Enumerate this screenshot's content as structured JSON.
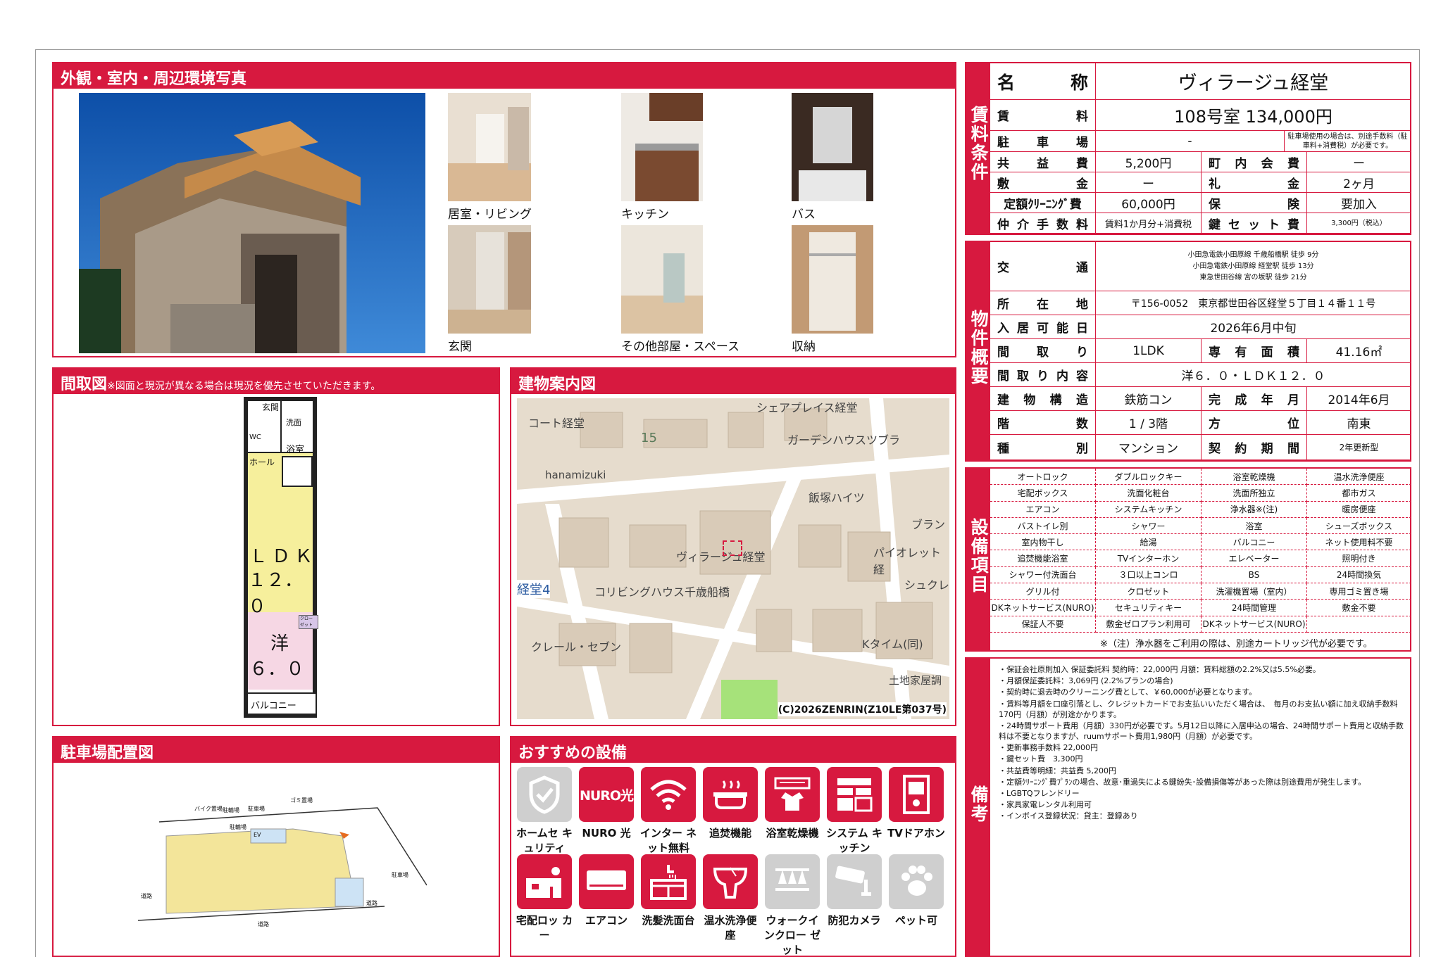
{
  "titles": {
    "photos": "外観・室内・周辺環境写真",
    "floorplan": "間取図",
    "floorplan_note": "※図面と現況が異なる場合は現況を優先させていただきます。",
    "map": "建物案内図",
    "parking": "駐車場配置図",
    "recommended": "おすすめの設備"
  },
  "photo_labels": [
    "居室・リビング",
    "キッチン",
    "バス",
    "玄関",
    "その他部屋・スペース",
    "収納"
  ],
  "floorplan": {
    "entrance": "玄関",
    "wash": "洗面",
    "wc": "WC",
    "bath": "浴室",
    "hall": "ホール",
    "ldk_1": "ＬＤＫ",
    "ldk_2": "１２．０",
    "closet": "クロー ゼット",
    "western_1": "洋",
    "western_2": "６．０",
    "balcony": "バルコニー"
  },
  "map": {
    "labels": [
      "シェアプレイス経堂",
      "コート経堂",
      "15",
      "ガーデンハウスツブラ",
      "hanamizuki",
      "飯塚ハイツ",
      "ブラン",
      "ヴィラージュ経堂",
      "パイオレット経",
      "経堂4",
      "コリビングハウス千歳船橋",
      "シュクレ",
      "クレール・セブン",
      "Kタイム(同)",
      "土地家屋調"
    ],
    "copyright": "(C)2026ZENRIN(Z10LE第037号)"
  },
  "parking": {
    "labels": [
      "バイク置場",
      "駐輪場",
      "駐車場",
      "ゴミ置場",
      "駐輪場",
      "EV",
      "道路",
      "道路",
      "道路",
      "駐車場"
    ]
  },
  "rent": {
    "section": "賃料条件",
    "name_label": "名称",
    "name": "ヴィラージュ経堂",
    "rent_label": "賃料",
    "rent": "108号室 134,000円",
    "parking_label": "駐車場",
    "parking": "-",
    "parking_note": "駐車場使用の場合は、別途手数料（駐車料+消費税）が必要です。",
    "common_label": "共益費",
    "common": "5,200円",
    "town_label": "町内会費",
    "town": "ー",
    "deposit_label": "敷金",
    "deposit": "ー",
    "key_money_label": "礼金",
    "key_money": "2ヶ月",
    "cleaning_label": "定額ｸﾘｰﾆﾝｸﾞ費",
    "cleaning": "60,000円",
    "insurance_label": "保険",
    "insurance": "要加入",
    "brokerage_label": "仲介手数料",
    "brokerage": "賃料1か月分+消費税",
    "keyset_label": "鍵セット費",
    "keyset": "3,300円（税込）"
  },
  "property": {
    "section": "物件概要",
    "transport_label": "交通",
    "transport": [
      "小田急電鉄小田原線 千歳船橋駅 徒歩 9分",
      "小田急電鉄小田原線 経堂駅 徒歩 13分",
      "東急世田谷線 宮の坂駅 徒歩 21分"
    ],
    "address_label": "所在地",
    "address": "〒156-0052　東京都世田谷区経堂５丁目１４番１１号",
    "movein_label": "入居可能日",
    "movein": "2026年6月中旬",
    "layout_label": "間取り",
    "layout": "1LDK",
    "area_label": "専有面積",
    "area": "41.16㎡",
    "layout_detail_label": "間取り内容",
    "layout_detail": "洋６．０・ＬＤＫ１２．０",
    "structure_label": "建物構造",
    "structure": "鉄筋コン",
    "built_label": "完成年月",
    "built": "2014年6月",
    "floor_label": "階数",
    "floor": "1 / 3階",
    "direction_label": "方位",
    "direction": "南東",
    "type_label": "種別",
    "type": "マンション",
    "contract_label": "契約期間",
    "contract": "2年更新型"
  },
  "equipment": {
    "section": "設備項目",
    "items": [
      "オートロック",
      "ダブルロックキー",
      "浴室乾燥機",
      "温水洗浄便座",
      "宅配ボックス",
      "洗面化粧台",
      "洗面所独立",
      "都市ガス",
      "エアコン",
      "システムキッチン",
      "浄水器※(注)",
      "暖房便座",
      "バストイレ別",
      "シャワー",
      "浴室",
      "シューズボックス",
      "室内物干し",
      "給湯",
      "バルコニー",
      "ネット使用料不要",
      "追焚機能浴室",
      "TVインターホン",
      "エレベーター",
      "照明付き",
      "シャワー付洗面台",
      "３口以上コンロ",
      "BS",
      "24時間換気",
      "グリル付",
      "クロゼット",
      "洗濯機置場（室内）",
      "専用ゴミ置き場",
      "DKネットサービス(NURO)",
      "セキュリティキー",
      "24時間管理",
      "敷金不要",
      "保証人不要",
      "敷金ゼロプラン利用可",
      "DKネットサービス(NURO)",
      ""
    ],
    "note": "※（注）浄水器をご利用の際は、別途カートリッジ代が必要です。"
  },
  "remarks": {
    "section": "備考",
    "items": [
      "・保証会社原則加入 保証委託料 契約時：22,000円 月額：賃料総額の2.2%又は5.5%必要。",
      "・月額保証委託料：3,069円 (2.2%プランの場合)",
      "・契約時に退去時のクリーニング費として、￥60,000が必要となります。",
      "・賃料等月額を口座引落とし、クレジットカードでお支払いいただく場合は、　毎月のお支払い額に加え収納手数料 170円（月額）が別途かかります。",
      "・24時間サポート費用（月額）330円が必要です。5月12日以降に入居申込の場合、24時間サポート費用と収納手数料は不要となりますが、ruumサポート費用1,980円（月額）が必要です。",
      "・更新事務手数料 22,000円",
      "・鍵セット費　3,300円",
      "・共益費等明細：共益費 5,200円",
      "・定額ｸﾘｰﾆﾝｸﾞ費ﾌﾟﾗﾝの場合、故意･重過失による鍵紛失･設備損傷等があった際は別途費用が発生します。",
      "・LGBTQフレンドリー",
      "・家具家電レンタル利用可",
      "・インボイス登録状況：貸主：登録あり"
    ]
  },
  "recommended": [
    {
      "label": "ホームセ キュリティ",
      "icon": "shield-icon",
      "active": false
    },
    {
      "label": "NURO 光",
      "icon": "nuro-icon",
      "active": true,
      "tile_text": "NURO光"
    },
    {
      "label": "インター ネット無料",
      "icon": "wifi-icon",
      "active": true
    },
    {
      "label": "追焚機能",
      "icon": "bathtub-icon",
      "active": true
    },
    {
      "label": "浴室乾燥機",
      "icon": "bath-dryer-icon",
      "active": true
    },
    {
      "label": "システム キッチン",
      "icon": "kitchen-icon",
      "active": true
    },
    {
      "label": "TVドアホン",
      "icon": "intercom-icon",
      "active": true
    },
    {
      "label": "宅配ロッ カー",
      "icon": "delivery-locker-icon",
      "active": true
    },
    {
      "label": "エアコン",
      "icon": "air-conditioner-icon",
      "active": true
    },
    {
      "label": "洗髪洗面台",
      "icon": "washbasin-icon",
      "active": true
    },
    {
      "label": "温水洗浄便 座",
      "icon": "toilet-icon",
      "active": true
    },
    {
      "label": "ウォークイ ンクロー ゼット",
      "icon": "closet-icon",
      "active": false
    },
    {
      "label": "防犯カメラ",
      "icon": "camera-icon",
      "active": false
    },
    {
      "label": "ペット可",
      "icon": "paw-icon",
      "active": false
    }
  ],
  "colors": {
    "accent": "#d7193f"
  }
}
